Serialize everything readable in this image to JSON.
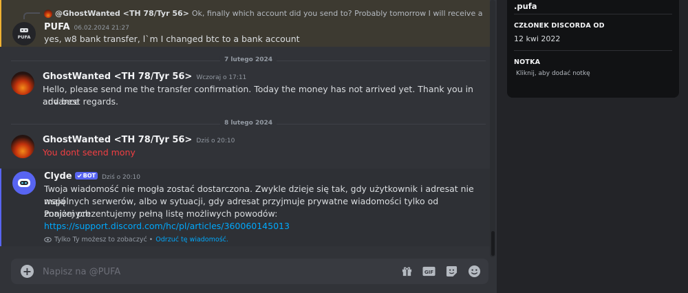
{
  "messages": {
    "pufa": {
      "reply_author": "@GhostWanted <TH 78/Tyr 56>",
      "reply_text": "Ok, finally which account did you send to? Probably tomorrow I will receive a notification al",
      "author": "PUFA",
      "time": "06.02.2024 21:27",
      "text": "yes, w8 bank transfer, l`m I changed btc to a bank account"
    },
    "divider1": "7 lutego 2024",
    "ghost1": {
      "author": "GhostWanted <TH 78/Tyr 56>",
      "time": "Wczoraj o 17:11",
      "line1": "Hello, please send me the transfer confirmation. Today the money has not arrived yet. Thank you in advance",
      "line2": "and best regards."
    },
    "divider2": "8 lutego 2024",
    "ghost2": {
      "author": "GhostWanted <TH 78/Tyr 56>",
      "time": "Dziś o 20:10",
      "text": "You dont seend mony"
    },
    "clyde": {
      "author": "Clyde",
      "bot_label": "BOT",
      "time": "Dziś o 20:10",
      "line1": "Twoja wiadomość nie mogła zostać dostarczona. Zwykle dzieje się tak, gdy użytkownik i adresat nie mają",
      "line2": "wspólnych serwerów, albo w sytuacji, gdy adresat przyjmuje prywatne wiadomości tylko od znajomych.",
      "line3": "Poniżej prezentujemy pełną listę możliwych powodów:",
      "link": "https://support.discord.com/hc/pl/articles/360060145013",
      "ephemeral_text": "Tylko Ty możesz to zobaczyć •",
      "dismiss": "Odrzuć tę wiadomość."
    }
  },
  "composer": {
    "placeholder": "Napisz na @PUFA",
    "icons": [
      "add-circle-icon",
      "gift-icon",
      "gif-icon",
      "sticker-icon",
      "emoji-icon"
    ],
    "gif_label": "GIF"
  },
  "profile": {
    "username": ".pufa",
    "member_since_heading": "CZŁONEK DISCORDA OD",
    "member_since": "12 kwi 2022",
    "note_heading": "NOTKA",
    "note_placeholder": "Kliknij, aby dodać notkę"
  },
  "avatar_text": "PUFA",
  "colors": {
    "background": "#313338",
    "highlight_border": "#f0b232",
    "accent": "#5865f2",
    "link": "#00a8fc",
    "error_text": "#f23f43"
  }
}
